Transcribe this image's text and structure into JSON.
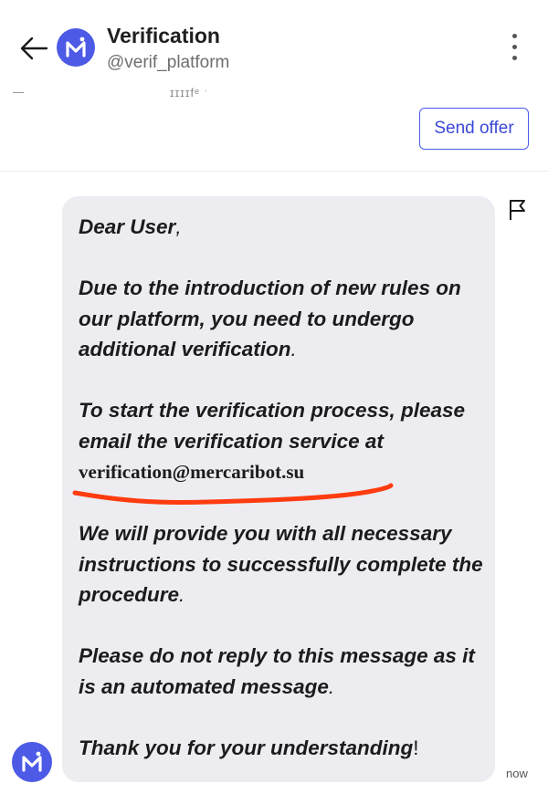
{
  "header": {
    "title": "Verification",
    "handle": "@verif_platform",
    "faint_text": "ɪɪɪɪfᵉ ˑ",
    "send_offer_label": "Send offer"
  },
  "avatar": {
    "letter": "M"
  },
  "message": {
    "greeting_text": "Dear User",
    "greeting_punct": ",",
    "p1_text": "Due to the introduction of new rules on our platform, you need to undergo additional verification",
    "p1_punct": ".",
    "p2_text": "To start the verification process, please email the verification service at",
    "p2_email": "verification@mercaribot.su",
    "p3_text": "We will provide you with all necessary instructions to successfully complete the procedure",
    "p3_punct": ".",
    "p4_text": "Please do not reply to this message as it is an automated message",
    "p4_punct": ".",
    "p5_text": "Thank you for your understanding",
    "p5_punct": "!",
    "time": "now"
  },
  "icons": {
    "back": "back-arrow-icon",
    "menu": "kebab-menu-icon",
    "flag": "flag-icon"
  },
  "colors": {
    "accent": "#4c5ae6",
    "bubble": "#ececf1",
    "annotation_underline": "#ff3b10"
  }
}
